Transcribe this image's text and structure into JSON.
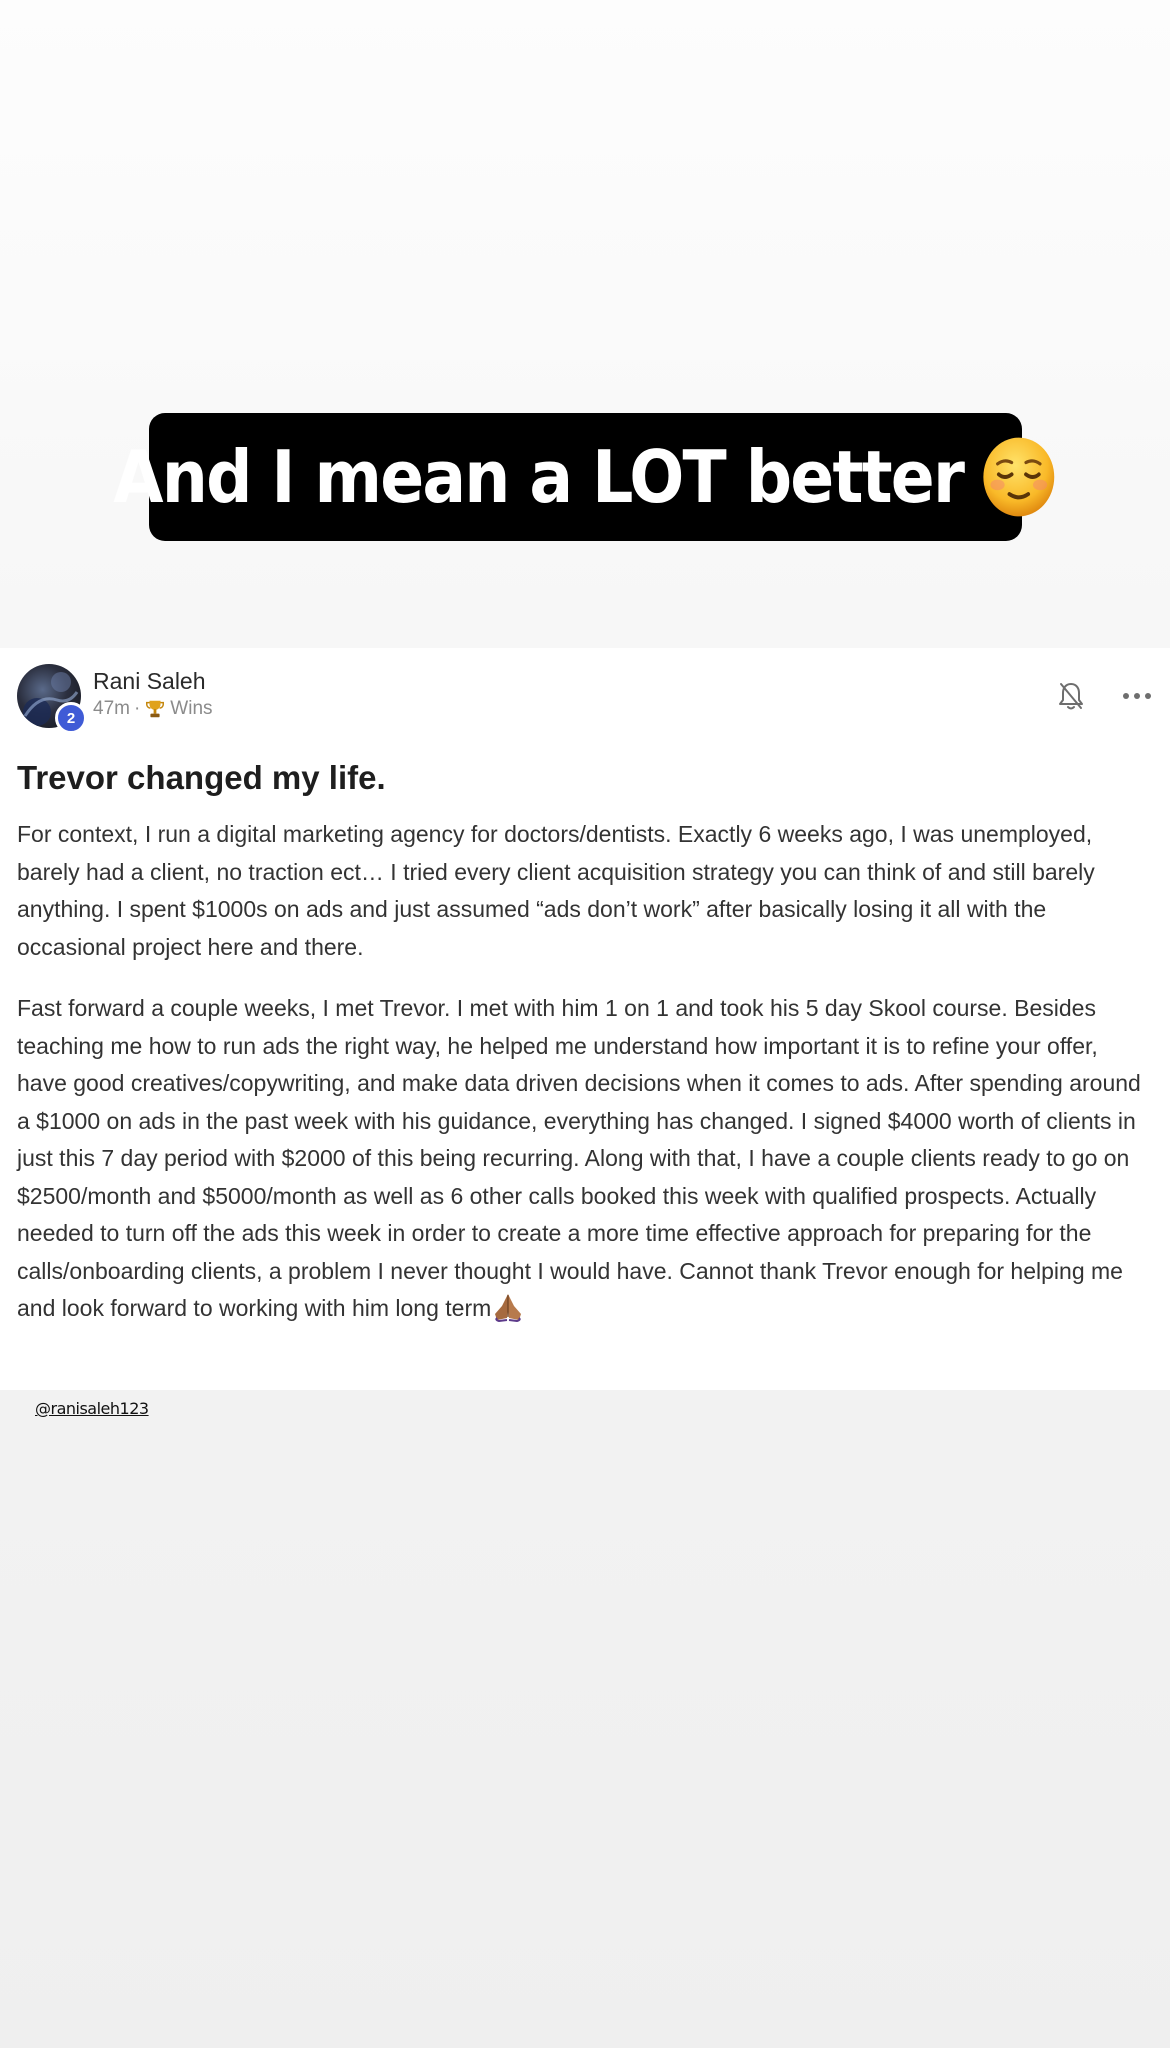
{
  "story": {
    "caption": "And I mean a LOT better",
    "caption_emoji": "relieved-face-emoji",
    "mention": "@ranisaleh123"
  },
  "post": {
    "author": "Rani Saleh",
    "level": "2",
    "time": "47m",
    "separator": "·",
    "category": "Wins",
    "category_icon": "trophy-icon",
    "title": "Trevor changed my life.",
    "paragraphs": [
      "For context, I run a digital marketing agency for doctors/dentists. Exactly 6 weeks ago, I was unemployed, barely had a client, no traction ect… I tried every client acquisition strategy you can think of and still barely anything. I spent $1000s on ads and just assumed “ads don’t work” after basically losing it all with the occasional project here and there.",
      "Fast forward a couple weeks, I met Trevor. I met with him 1 on 1 and took his 5 day Skool course. Besides teaching me how to run ads the right way, he helped me understand how important it is to refine your offer, have good creatives/copywriting, and make data driven decisions when it comes to ads. After spending around a $1000 on ads in the past week with his guidance, everything has changed. I signed $4000 worth of clients in just this 7 day period with $2000 of this being recurring. Along with that, I have a couple clients ready to go on $2500/month and $5000/month as well as 6 other calls booked this week with qualified prospects. Actually needed to turn off the ads this week in order to create a more time effective approach for preparing for the calls/onboarding clients, a problem I never thought I would have. Cannot thank Trevor enough for helping me and look forward to working with him long term"
    ],
    "closing_emoji": "folded-hands-emoji"
  },
  "colors": {
    "caption_bg": "#000000",
    "caption_text": "#ffffff",
    "badge": "#3f5bd6",
    "meta_text": "#8b8b8b"
  }
}
